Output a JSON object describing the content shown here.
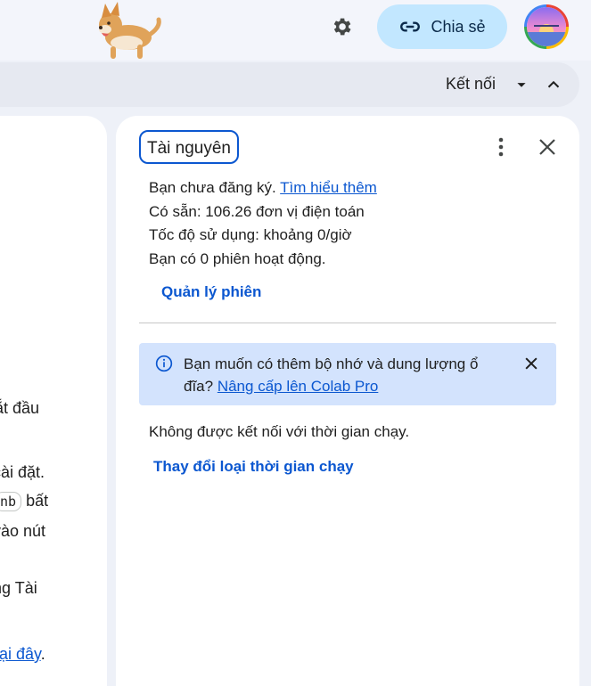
{
  "header": {
    "share_label": "Chia sẻ",
    "icons": {
      "settings": "gear-icon",
      "share": "link-icon",
      "mascot": "corgi-mascot",
      "avatar": "profile-avatar"
    }
  },
  "toolbar": {
    "connect_label": "Kết nối"
  },
  "left_fragments": {
    "line1": "ắt đầu",
    "line2": "cài đặt.",
    "line3_chip": "nb",
    "line3_text": "bất",
    "line4": "vào nút",
    "line5": "ng Tài",
    "line6_link": "tại đây",
    "line6_end": "."
  },
  "resources": {
    "title": "Tài nguyên",
    "not_subscribed": "Bạn chưa đăng ký.",
    "learn_more": "Tìm hiểu thêm",
    "available": "Có sẵn: 106.26 đơn vị điện toán",
    "usage_rate": "Tốc độ sử dụng: khoảng 0/giờ",
    "sessions": "Bạn có 0 phiên hoạt động.",
    "manage_sessions": "Quản lý phiên",
    "banner_text_1": "Bạn muốn có thêm bộ nhớ và dung lượng ổ đĩa?",
    "banner_link": "Nâng cấp lên Colab Pro",
    "not_connected": "Không được kết nối với thời gian chạy.",
    "change_runtime": "Thay đổi loại thời gian chạy"
  },
  "colors": {
    "accent": "#0b57d0",
    "share_bg": "#c2e7ff",
    "banner_bg": "#d3e3fd"
  }
}
